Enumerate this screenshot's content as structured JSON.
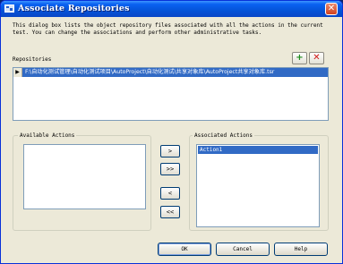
{
  "window": {
    "title": "Associate Repositories",
    "close_label": "✕"
  },
  "description": "This dialog box lists the object repository files associated with all the actions in the current test. You can change the associations and perform other administrative tasks.",
  "repositories": {
    "label": "Repositories",
    "add_label": "+",
    "remove_label": "✕",
    "rows": [
      {
        "marker": "▶",
        "path": "F:\\自动化测试管理\\自动化测试项目\\AutoProject\\自动化测试\\共享对象库\\AutoProject共享对象库.tsr"
      }
    ]
  },
  "available_actions": {
    "label": "Available Actions",
    "items": []
  },
  "associated_actions": {
    "label": "Associated Actions",
    "items": [
      "Action1"
    ]
  },
  "transfer_buttons": {
    "add_one": ">",
    "add_all": ">>",
    "remove_one": "<",
    "remove_all": "<<"
  },
  "buttons": {
    "ok": "OK",
    "cancel": "Cancel",
    "help": "Help"
  },
  "colors": {
    "title_bar": "#0453d8",
    "selection": "#316ac5",
    "dialog_bg": "#ece9d8"
  }
}
